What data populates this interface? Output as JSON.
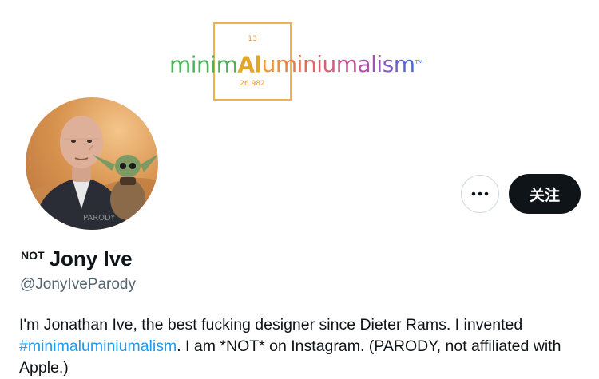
{
  "banner": {
    "element_number": "13",
    "element_mass": "26.982",
    "wordmark_pre": "minim",
    "wordmark_symbol": "Al",
    "wordmark_post": "uminiumalism",
    "wordmark_tm": "TM"
  },
  "avatar": {
    "watermark": "PARODY"
  },
  "actions": {
    "more_label": "•••",
    "follow_label": "关注"
  },
  "profile": {
    "name_prefix": "NOT",
    "name": "Jony Ive",
    "handle": "@JonyIveParody",
    "bio_part1": "I'm Jonathan Ive, the best fucking designer since Dieter Rams. I invented ",
    "bio_hashtag": "#minimaluminiumalism",
    "bio_part2": ". I am *NOT* on Instagram. (PARODY, not affiliated with Apple.)"
  },
  "colors": {
    "accent": "#1d9bf0",
    "button_dark": "#0f1419",
    "muted": "#536471"
  }
}
